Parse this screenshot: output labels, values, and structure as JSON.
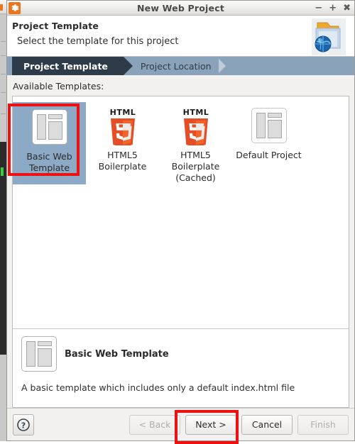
{
  "window": {
    "title": "New Web Project",
    "app_icon": "gear-icon",
    "controls": {
      "minimize": "−",
      "maximize": "+",
      "close": "✖"
    }
  },
  "header": {
    "title": "Project Template",
    "subtitle": "Select the template for this project",
    "icon": "folder-globe-icon"
  },
  "steps": [
    {
      "label": "Project Template",
      "active": true
    },
    {
      "label": "Project Location",
      "active": false
    }
  ],
  "main": {
    "available_label": "Available Templates:",
    "templates": [
      {
        "label": "Basic Web\nTemplate",
        "line1": "Basic Web",
        "line2": "Template",
        "icon": "web-layout-icon",
        "selected": true
      },
      {
        "label": "HTML5\nBoilerplate",
        "line1": "HTML5",
        "line2": "Boilerplate",
        "icon": "html5-shield-icon",
        "selected": false
      },
      {
        "label": "HTML5\nBoilerplate\n(Cached)",
        "line1": "HTML5",
        "line2": "Boilerplate",
        "line3": "(Cached)",
        "icon": "html5-shield-icon",
        "selected": false
      },
      {
        "label": "Default Project",
        "line1": "Default Project",
        "line2": "",
        "icon": "web-layout-icon",
        "selected": false
      }
    ]
  },
  "description": {
    "title": "Basic Web Template",
    "icon": "web-layout-icon",
    "text": "A basic template which includes only a default index.html file"
  },
  "footer": {
    "help_icon": "question-mark-icon",
    "buttons": [
      {
        "label": "< Back",
        "enabled": false
      },
      {
        "label": "Next >",
        "enabled": true
      },
      {
        "label": "Cancel",
        "enabled": true
      },
      {
        "label": "Finish",
        "enabled": false
      }
    ]
  },
  "annotations": {
    "accent_color": "#ee1111",
    "highlighted": [
      "Basic Web Template tile",
      "Next > button"
    ]
  },
  "colors": {
    "titlebar_icon": "#e8761f",
    "step_bar": "#8ba2bb",
    "step_active": "#2e3b48",
    "selection": "#8ca9c5",
    "html5_red": "#e44d26",
    "html5_red_light": "#f16529"
  }
}
